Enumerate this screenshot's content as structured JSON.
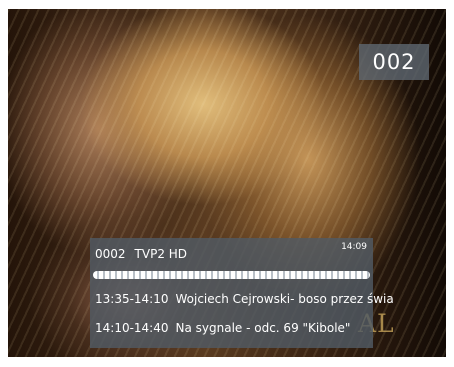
{
  "channel_number_display": "002",
  "info_bar": {
    "channel_id": "0002",
    "channel_name": "TVP2 HD",
    "clock": "14:09",
    "progress_percent": 100,
    "now": {
      "time": "13:35-14:10",
      "title": "Wojciech Cejrowski- boso przez świa"
    },
    "next": {
      "time": "14:10-14:40",
      "title": "Na sygnale - odc. 69 \"Kibole\""
    }
  },
  "background_watermark": "AL"
}
